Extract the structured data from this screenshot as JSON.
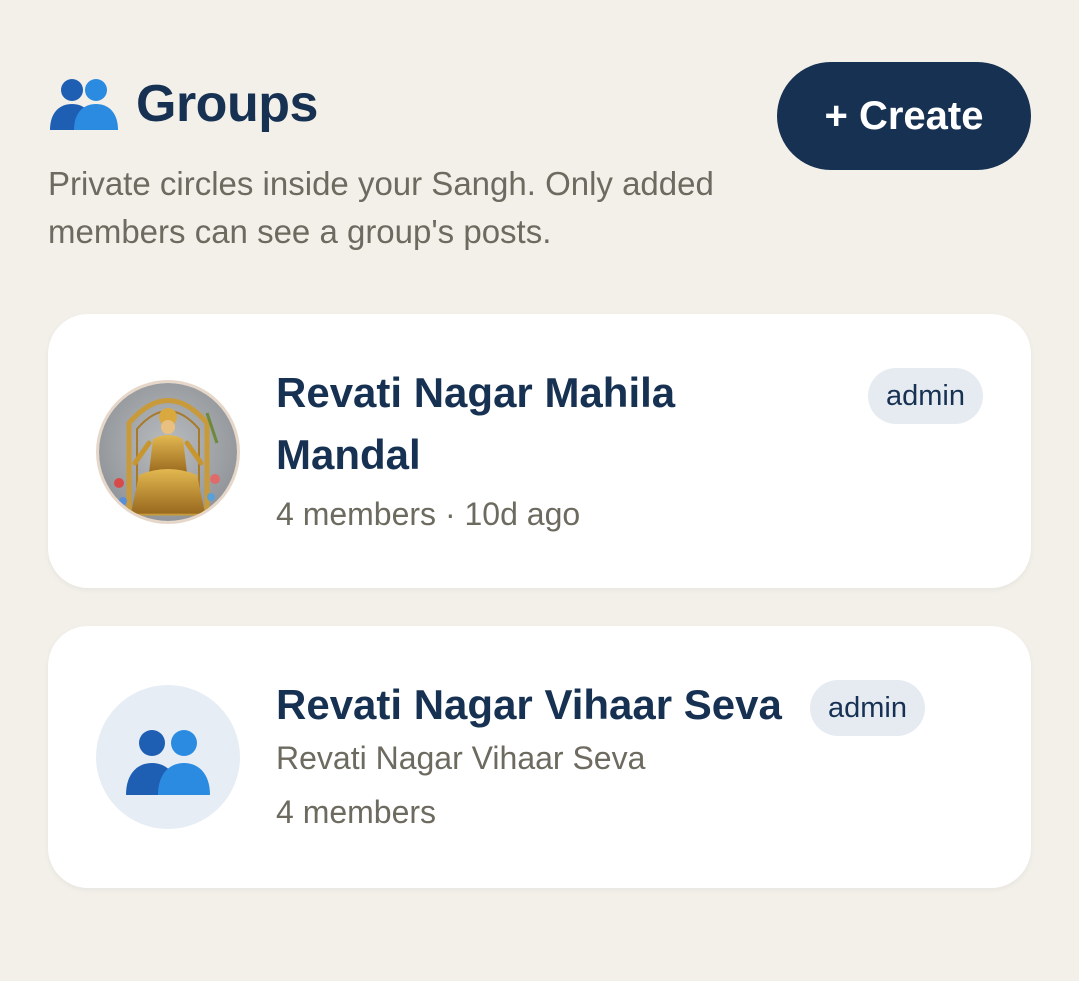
{
  "header": {
    "icon": "people-icon",
    "title": "Groups",
    "subtitle": "Private circles inside your Sangh. Only added members can see a group's posts.",
    "create_label": "+ Create"
  },
  "colors": {
    "background": "#f3f0ea",
    "primary": "#173152",
    "muted_text": "#6d6a5f",
    "badge_bg": "#e6ebf2",
    "icon_blue_dark": "#1f5fb3",
    "icon_blue_light": "#2a8be0"
  },
  "groups": [
    {
      "name": "Revati Nagar Mahila Mandal",
      "role": "admin",
      "meta": "4 members · 10d ago",
      "avatar": "goddess-image"
    },
    {
      "name": "Revati Nagar Vihaar Seva",
      "role": "admin",
      "description": "Revati Nagar Vihaar Seva",
      "meta": "4 members",
      "avatar": "people-icon"
    }
  ]
}
